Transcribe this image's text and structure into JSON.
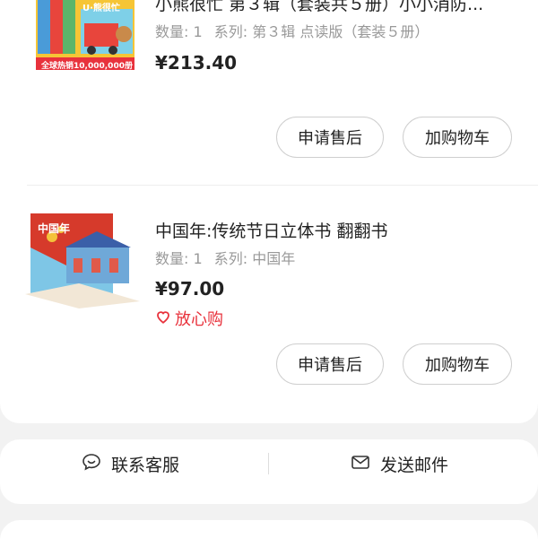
{
  "colors": {
    "accent": "#e8323c",
    "text": "#222222",
    "muted": "#999999",
    "background": "#f2f2f2"
  },
  "items": [
    {
      "title": "小熊很忙 第３辑（套装共５册）小小消防...",
      "quantity_label": "数量: 1",
      "series_label": "系列: 第３辑 点读版（套装５册）",
      "price": "¥213.40",
      "cover_banner": "全球热销10,000,000册",
      "cover_text": "U·熊很忙"
    },
    {
      "title": "中国年:传统节日立体书 翻翻书",
      "quantity_label": "数量: 1",
      "series_label": "系列: 中国年",
      "price": "¥97.00",
      "badge": "放心购",
      "badge_icon": "heart-icon",
      "cover_text": "中国年"
    }
  ],
  "buttons": {
    "after_sales": "申请售后",
    "add_cart": "加购物车"
  },
  "footer": {
    "contact": {
      "label": "联系客服",
      "icon": "chat-bubble-icon"
    },
    "mail": {
      "label": "发送邮件",
      "icon": "mail-icon"
    }
  }
}
